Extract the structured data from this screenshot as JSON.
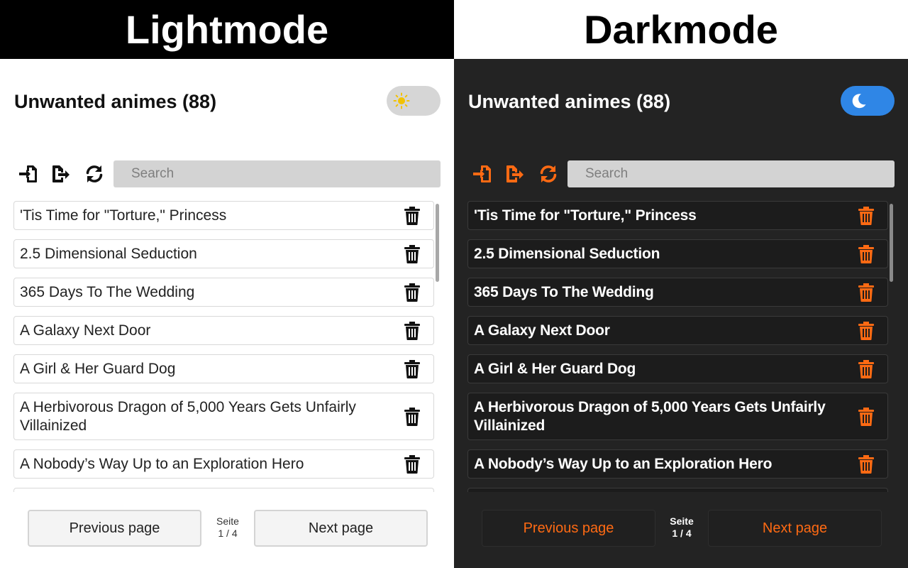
{
  "labels": {
    "light": "Lightmode",
    "dark": "Darkmode"
  },
  "app": {
    "title": "Unwanted animes (88)",
    "search_placeholder": "Search",
    "items": [
      "'Tis Time for \"Torture,\" Princess",
      "2.5 Dimensional Seduction",
      "365 Days To The Wedding",
      "A Galaxy Next Door",
      "A Girl & Her Guard Dog",
      "A Herbivorous Dragon of 5,000 Years Gets Unfairly Villainized",
      "A Nobody’s Way Up to an Exploration Hero"
    ],
    "prev_label": "Previous page",
    "next_label": "Next page",
    "page_word": "Seite",
    "page_count": "1 / 4"
  },
  "colors": {
    "accent_dark": "#ff6a13",
    "toggle_dark": "#2f86e6",
    "toggle_light": "#d6d6d6",
    "sun": "#f2c200"
  },
  "icons": [
    "import-icon",
    "export-icon",
    "refresh-icon",
    "trash-icon",
    "sun-icon",
    "moon-icon"
  ]
}
